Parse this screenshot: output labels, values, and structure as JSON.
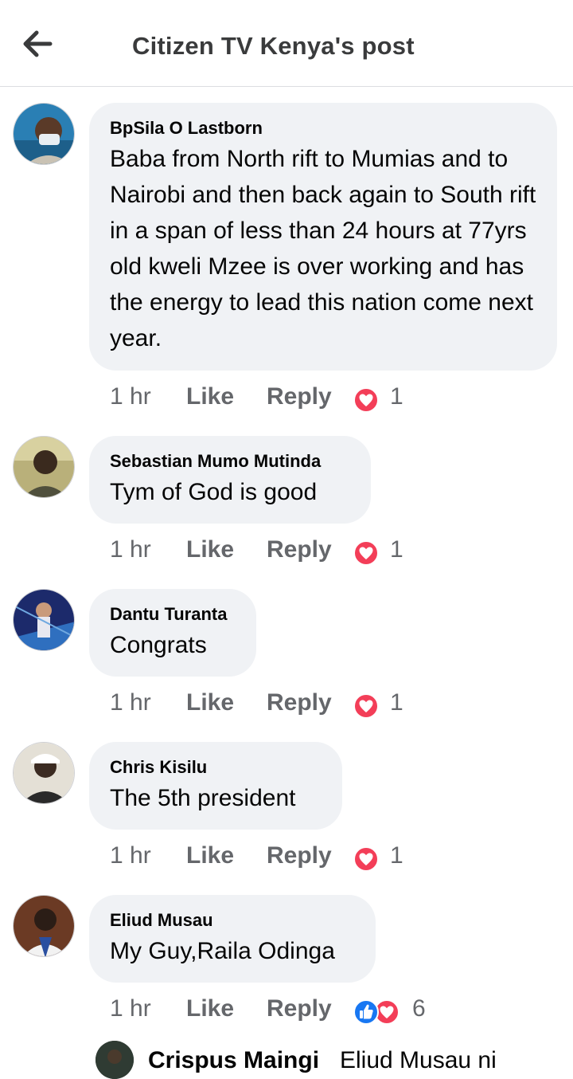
{
  "header": {
    "title": "Citizen TV Kenya's post",
    "back_icon": "arrow-left-icon"
  },
  "colors": {
    "bubble": "#f0f2f5",
    "secondary_text": "#65676b",
    "love": "#f33e58",
    "like": "#1877f2"
  },
  "comments": [
    {
      "author": "BpSila O Lastborn",
      "text": "Baba from North rift to Mumias and to Nairobi and then back again to South rift in a span of less than 24 hours at 77yrs old kweli Mzee is over working and has the energy to lead this nation come next year.",
      "time": "1 hr",
      "like_label": "Like",
      "reply_label": "Reply",
      "reactions": [
        "love"
      ],
      "reaction_count": "1"
    },
    {
      "author": "Sebastian Mumo Mutinda",
      "text": "Tym of God is good",
      "time": "1 hr",
      "like_label": "Like",
      "reply_label": "Reply",
      "reactions": [
        "love"
      ],
      "reaction_count": "1"
    },
    {
      "author": "Dantu Turanta",
      "text": "Congrats",
      "time": "1 hr",
      "like_label": "Like",
      "reply_label": "Reply",
      "reactions": [
        "love"
      ],
      "reaction_count": "1"
    },
    {
      "author": "Chris Kisilu",
      "text": "The 5th president",
      "time": "1 hr",
      "like_label": "Like",
      "reply_label": "Reply",
      "reactions": [
        "love"
      ],
      "reaction_count": "1"
    },
    {
      "author": "Eliud Musau",
      "text": "My Guy,Raila Odinga",
      "time": "1 hr",
      "like_label": "Like",
      "reply_label": "Reply",
      "reactions": [
        "like",
        "love"
      ],
      "reaction_count": "6"
    }
  ],
  "reply_preview": {
    "author": "Crispus Maingi",
    "text": "Eliud Musau ni"
  }
}
